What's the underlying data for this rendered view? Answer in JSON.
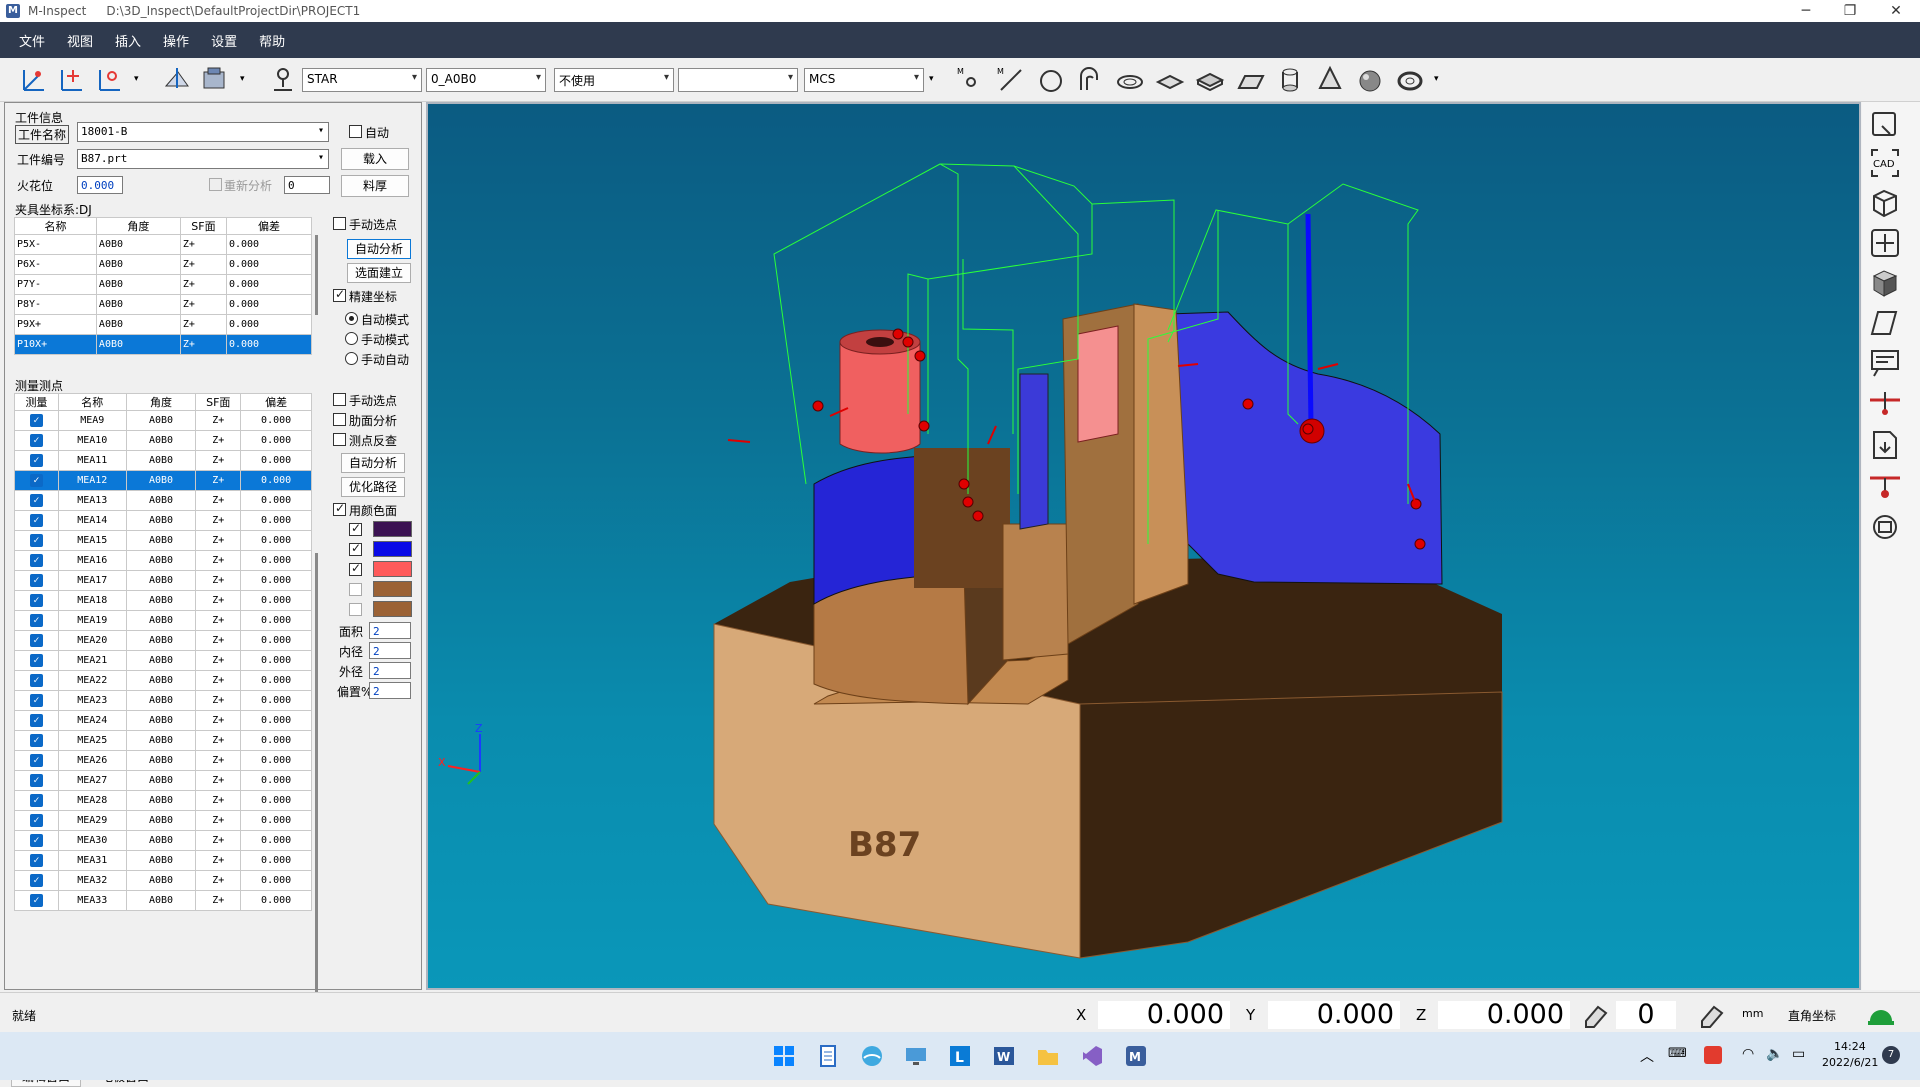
{
  "titlebar": {
    "app": "M-Inspect",
    "path": "D:\\3D_Inspect\\DefaultProjectDir\\PROJECT1"
  },
  "menu": [
    "文件",
    "视图",
    "插入",
    "操作",
    "设置",
    "帮助"
  ],
  "toolbar": {
    "combo1": "STAR",
    "combo2": "0_A0B0",
    "combo3": "不使用",
    "combo4": "",
    "combo5": "MCS"
  },
  "workpiece": {
    "section": "工件信息",
    "name_label": "工件名称",
    "name_value": "18001-B",
    "auto_label": "自动",
    "id_label": "工件编号",
    "id_value": "B87.prt",
    "load_label": "载入",
    "spark_label": "火花位",
    "spark_value": "0.000",
    "reanalyze_label": "重新分析",
    "reanalyze_value": "0",
    "stock_label": "料厚"
  },
  "fixture": {
    "title": "夹具坐标系:DJ",
    "headers": [
      "名称",
      "角度",
      "SF面",
      "偏差"
    ],
    "rows": [
      [
        "P5X-",
        "A0B0",
        "Z+",
        "0.000"
      ],
      [
        "P6X-",
        "A0B0",
        "Z+",
        "0.000"
      ],
      [
        "P7Y-",
        "A0B0",
        "Z+",
        "0.000"
      ],
      [
        "P8Y-",
        "A0B0",
        "Z+",
        "0.000"
      ],
      [
        "P9X+",
        "A0B0",
        "Z+",
        "0.000"
      ],
      [
        "P10X+",
        "A0B0",
        "Z+",
        "0.000"
      ]
    ],
    "manual_pick": "手动选点",
    "auto_analyze": "自动分析",
    "select_build": "选面建立",
    "precise": "精建坐标",
    "mode_auto": "自动模式",
    "mode_manual": "手动模式",
    "mode_manual_auto": "手动自动"
  },
  "measure": {
    "title": "测量测点",
    "headers": [
      "测量",
      "名称",
      "角度",
      "SF面",
      "偏差"
    ],
    "rows": [
      [
        "MEA9",
        "A0B0",
        "Z+",
        "0.000"
      ],
      [
        "MEA10",
        "A0B0",
        "Z+",
        "0.000"
      ],
      [
        "MEA11",
        "A0B0",
        "Z+",
        "0.000"
      ],
      [
        "MEA12",
        "A0B0",
        "Z+",
        "0.000"
      ],
      [
        "MEA13",
        "A0B0",
        "Z+",
        "0.000"
      ],
      [
        "MEA14",
        "A0B0",
        "Z+",
        "0.000"
      ],
      [
        "MEA15",
        "A0B0",
        "Z+",
        "0.000"
      ],
      [
        "MEA16",
        "A0B0",
        "Z+",
        "0.000"
      ],
      [
        "MEA17",
        "A0B0",
        "Z+",
        "0.000"
      ],
      [
        "MEA18",
        "A0B0",
        "Z+",
        "0.000"
      ],
      [
        "MEA19",
        "A0B0",
        "Z+",
        "0.000"
      ],
      [
        "MEA20",
        "A0B0",
        "Z+",
        "0.000"
      ],
      [
        "MEA21",
        "A0B0",
        "Z+",
        "0.000"
      ],
      [
        "MEA22",
        "A0B0",
        "Z+",
        "0.000"
      ],
      [
        "MEA23",
        "A0B0",
        "Z+",
        "0.000"
      ],
      [
        "MEA24",
        "A0B0",
        "Z+",
        "0.000"
      ],
      [
        "MEA25",
        "A0B0",
        "Z+",
        "0.000"
      ],
      [
        "MEA26",
        "A0B0",
        "Z+",
        "0.000"
      ],
      [
        "MEA27",
        "A0B0",
        "Z+",
        "0.000"
      ],
      [
        "MEA28",
        "A0B0",
        "Z+",
        "0.000"
      ],
      [
        "MEA29",
        "A0B0",
        "Z+",
        "0.000"
      ],
      [
        "MEA30",
        "A0B0",
        "Z+",
        "0.000"
      ],
      [
        "MEA31",
        "A0B0",
        "Z+",
        "0.000"
      ],
      [
        "MEA32",
        "A0B0",
        "Z+",
        "0.000"
      ],
      [
        "MEA33",
        "A0B0",
        "Z+",
        "0.000"
      ]
    ],
    "manual_pick": "手动选点",
    "rib_analyze": "肋面分析",
    "reverse": "测点反查",
    "auto_analyze": "自动分析",
    "optimize": "优化路径",
    "use_color": "用颜色面",
    "colors": [
      "#3b1252",
      "#0a0ae6",
      "#ff5a5a",
      "#9b6235",
      "#9b6235"
    ],
    "area_label": "面积",
    "area_value": "2",
    "inner_label": "内径",
    "inner_value": "2",
    "outer_label": "外径",
    "outer_value": "2",
    "offset_label": "偏置%",
    "offset_value": "2"
  },
  "tabs": {
    "edit": "编辑窗口",
    "electrode": "电极窗口"
  },
  "model": {
    "label": "B87"
  },
  "status": {
    "ready": "就绪",
    "x_label": "X",
    "x": "0.000",
    "y_label": "Y",
    "y": "0.000",
    "z_label": "Z",
    "z": "0.000",
    "angle": "0",
    "unit": "mm",
    "coord": "直角坐标"
  },
  "taskbar": {
    "time": "14:24",
    "date": "2022/6/21",
    "badge": "7"
  }
}
